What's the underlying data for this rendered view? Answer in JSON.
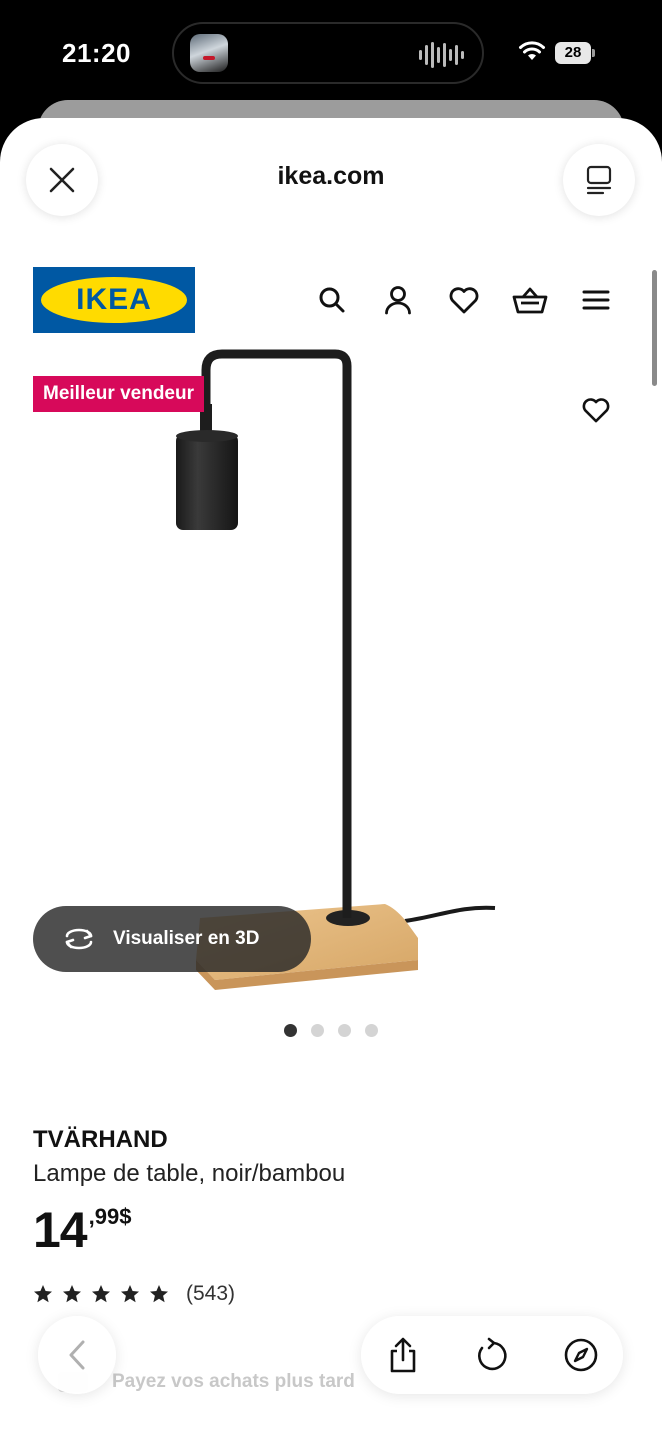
{
  "status_bar": {
    "time": "21:20",
    "battery": "28"
  },
  "browser": {
    "url": "ikea.com"
  },
  "header": {
    "logo_text": "IKEA",
    "icons": [
      "search-icon",
      "user-icon",
      "heart-icon",
      "basket-icon",
      "menu-icon"
    ]
  },
  "product": {
    "badge": "Meilleur vendeur",
    "view_3d_label": "Visualiser en 3D",
    "image_dots": {
      "count": 4,
      "active": 1
    },
    "name": "TVÄRHAND",
    "description": "Lampe de table, noir/bambou",
    "price_integer": "14",
    "price_decimal": ",99$",
    "rating": 5,
    "review_count": "(543)"
  },
  "promo": {
    "text": "Payez vos achats plus tard"
  },
  "colors": {
    "ikea_blue": "#0058a3",
    "ikea_yellow": "#ffdb00",
    "badge_pink": "#d7095a"
  }
}
